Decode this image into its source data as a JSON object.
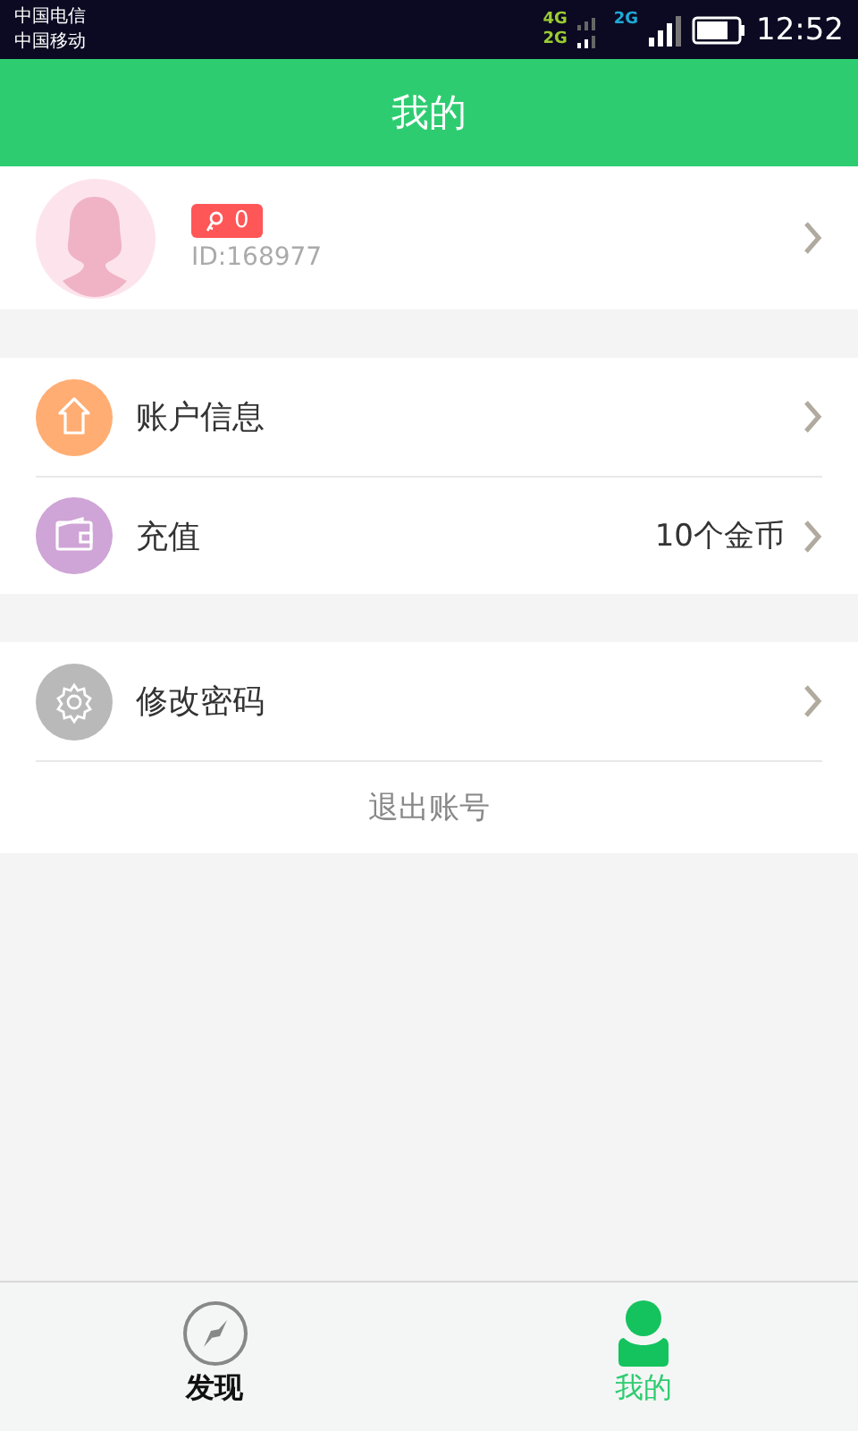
{
  "status_bar": {
    "carriers": [
      "中国电信",
      "中国移动"
    ],
    "network_labels": [
      "4G",
      "2G",
      "2G"
    ],
    "time": "12:52"
  },
  "header": {
    "title": "我的"
  },
  "profile": {
    "badge": "0",
    "id": "ID:168977"
  },
  "sections": [
    {
      "items": [
        {
          "label": "账户信息",
          "value": null,
          "color": "#ffad73"
        },
        {
          "label": "充值",
          "value": "10个金币",
          "color": "#cfa4d6"
        }
      ]
    },
    {
      "items": [
        {
          "label": "修改密码",
          "value": null,
          "color": "#b9b9b9"
        }
      ],
      "logout": "退出账号"
    }
  ],
  "tabs": [
    {
      "label": "发现",
      "selected": false
    },
    {
      "label": "我的",
      "selected": true
    }
  ]
}
